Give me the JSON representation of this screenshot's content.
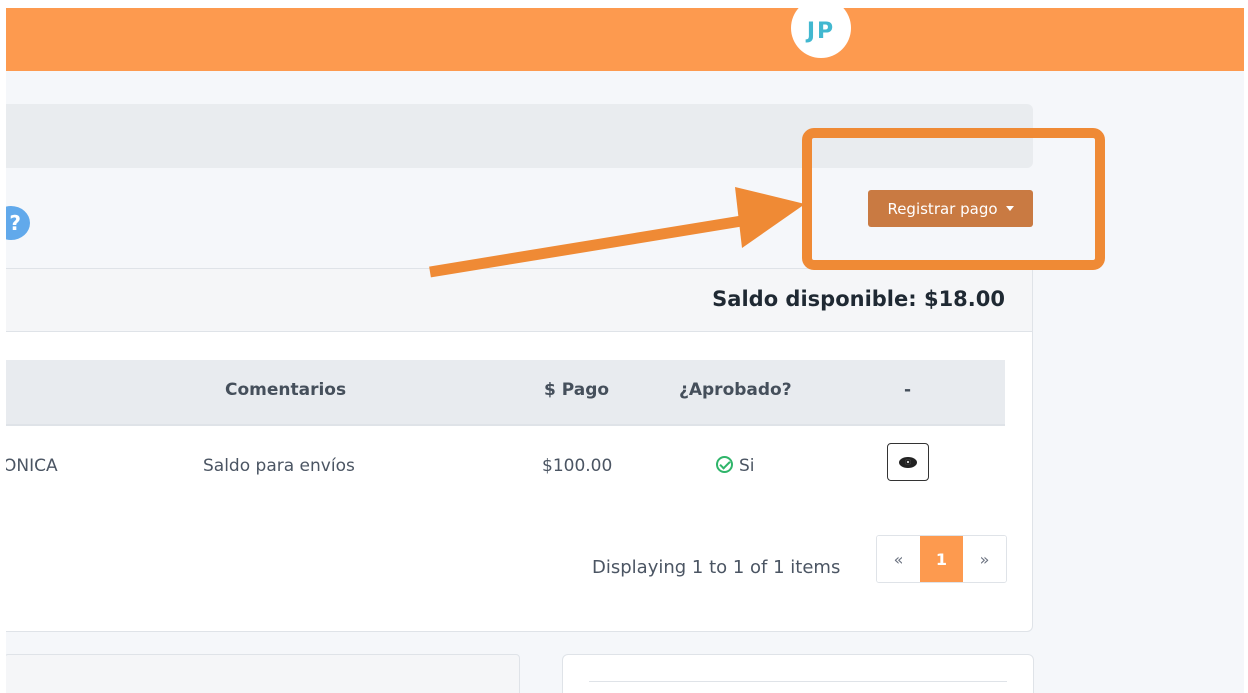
{
  "header": {
    "avatar_initials": "JP"
  },
  "help": {
    "icon": "?"
  },
  "actions": {
    "register_label": "Registrar pago"
  },
  "balance": {
    "label": "Saldo disponible: $18.00"
  },
  "table": {
    "columns": [
      "Comentarios",
      "$ Pago",
      "¿Aprobado?",
      "-"
    ],
    "rows": [
      {
        "partial_first_col": "ONICA",
        "comentarios": "Saldo para envíos",
        "pago": "$100.00",
        "aprobado": "Si"
      }
    ]
  },
  "pagination": {
    "info": "Displaying 1 to 1 of 1 items",
    "prev": "«",
    "current": "1",
    "next": "»"
  },
  "colors": {
    "topbar": "#fd9a4f",
    "accent_button": "#c97a42",
    "annotation": "#ef8a35",
    "approved": "#2fb56a"
  }
}
